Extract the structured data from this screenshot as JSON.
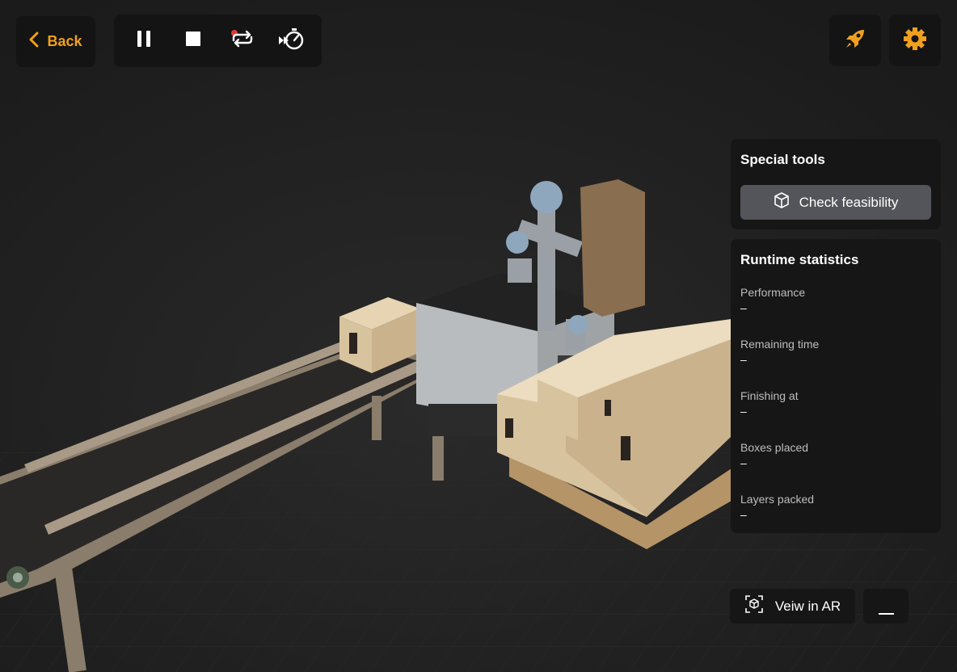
{
  "toolbar": {
    "back_label": "Back",
    "controls": [
      "pause-icon",
      "stop-icon",
      "record-repeat-icon",
      "fast-forward-timer-icon"
    ],
    "right_buttons": [
      "rocket-icon",
      "gear-icon"
    ]
  },
  "colors": {
    "accent": "#f0a01e",
    "panel_bg": "#161616",
    "button_gray": "#54555a",
    "record_dot": "#e53935"
  },
  "special_tools": {
    "title": "Special tools",
    "check_label": "Check feasibility",
    "check_icon": "cube-icon"
  },
  "runtime": {
    "title": "Runtime statistics",
    "items": [
      {
        "label": "Performance",
        "value": "–"
      },
      {
        "label": "Remaining time",
        "value": "–"
      },
      {
        "label": "Finishing at",
        "value": "–"
      },
      {
        "label": "Boxes placed",
        "value": "–"
      },
      {
        "label": "Layers packed",
        "value": "–"
      }
    ]
  },
  "ar": {
    "label": "Veiw in AR",
    "icon": "ar-cube-icon"
  },
  "minimize_icon": "minimize-icon"
}
